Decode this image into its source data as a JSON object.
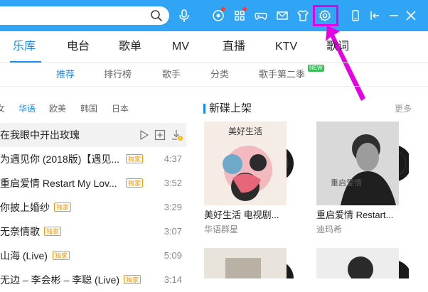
{
  "titlebar": {
    "color": "#31a5f5",
    "icons": [
      "search-icon",
      "microphone-icon",
      "radar-icon",
      "apps-icon",
      "gamepad-icon",
      "mail-icon",
      "shirt-icon",
      "gear-icon",
      "phone-icon",
      "collapse-icon",
      "minimize-icon",
      "close-icon"
    ]
  },
  "main_nav": [
    {
      "label": "乐库",
      "active": true
    },
    {
      "label": "电台",
      "active": false
    },
    {
      "label": "歌单",
      "active": false
    },
    {
      "label": "MV",
      "active": false
    },
    {
      "label": "直播",
      "active": false
    },
    {
      "label": "KTV",
      "active": false
    },
    {
      "label": "歌词",
      "active": false
    }
  ],
  "sub_nav": [
    {
      "label": "推荐",
      "active": true
    },
    {
      "label": "排行榜",
      "active": false
    },
    {
      "label": "歌手",
      "active": false
    },
    {
      "label": "分类",
      "active": false
    },
    {
      "label": "歌手第二季",
      "active": false
    }
  ],
  "new_badge": "NEW",
  "lang_tabs": [
    {
      "label": "女",
      "active": false
    },
    {
      "label": "华语",
      "active": true
    },
    {
      "label": "欧美",
      "active": false
    },
    {
      "label": "韩国",
      "active": false
    },
    {
      "label": "日本",
      "active": false
    }
  ],
  "songs": [
    {
      "title": "在我眼中开出玫瑰",
      "vip": "",
      "duration": "",
      "highlighted": true
    },
    {
      "title": "为遇见你 (2018版)【遇见...",
      "vip": "独家",
      "duration": "4:37"
    },
    {
      "title": "重启爱情 Restart My Lov...",
      "vip": "独家",
      "duration": "3:52"
    },
    {
      "title": "你披上婚纱",
      "vip": "独家",
      "duration": "3:29"
    },
    {
      "title": "无奈情歌",
      "vip": "独家",
      "duration": "3:07"
    },
    {
      "title": "山海 (Live)",
      "vip": "独家",
      "duration": "5:09"
    },
    {
      "title": "无边 – 李会彬 – 李聪 (Live)",
      "vip": "独家",
      "duration": "3:14"
    }
  ],
  "new_albums": {
    "title": "新碟上架",
    "more": "更多",
    "items": [
      {
        "title": "美好生活 电视剧...",
        "artist": "华语群星",
        "cover_text": "美好生活"
      },
      {
        "title": "重启爱情 Restart...",
        "artist": "迪玛希",
        "cover_text": "重启爱情"
      }
    ]
  },
  "colors": {
    "accent": "#1a8de8",
    "highlight": "#e600e6",
    "vip": "#f39800"
  }
}
